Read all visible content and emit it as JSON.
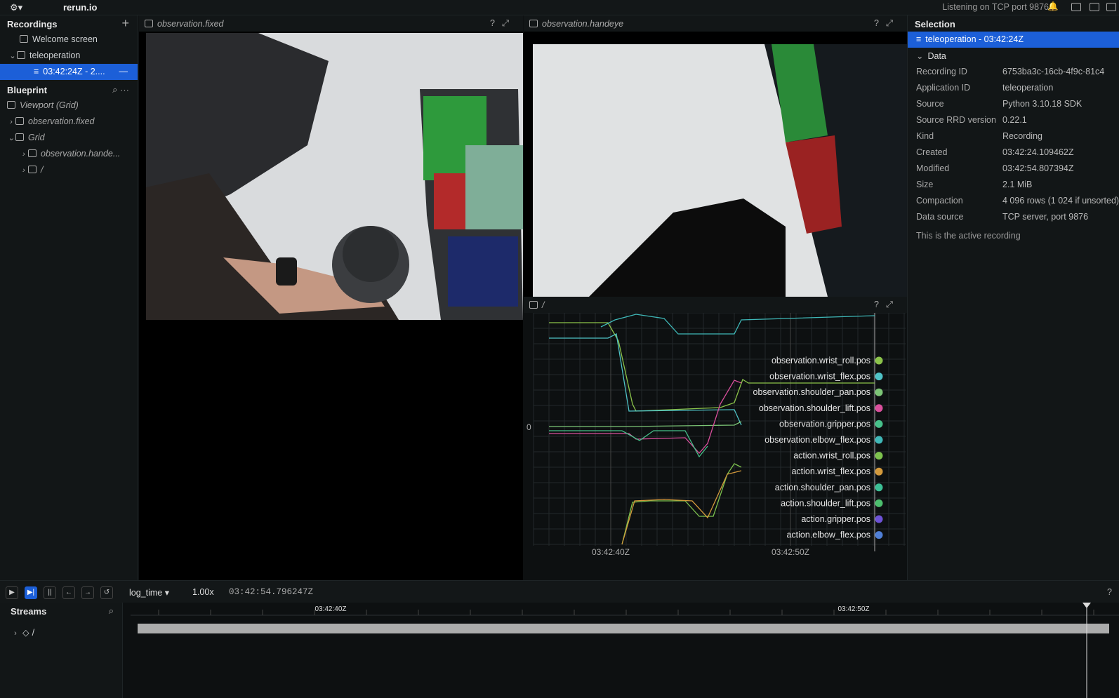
{
  "app": {
    "name": "rerun.io",
    "status": "Listening on TCP port 9876"
  },
  "recordings": {
    "title": "Recordings",
    "items": [
      {
        "label": "Welcome screen"
      },
      {
        "label": "teleoperation"
      },
      {
        "label": "03:42:24Z - 2...."
      }
    ]
  },
  "blueprint": {
    "title": "Blueprint",
    "items": [
      {
        "label": "Viewport (Grid)"
      },
      {
        "label": "observation.fixed"
      },
      {
        "label": "Grid"
      },
      {
        "label": "observation.hande..."
      },
      {
        "label": "/"
      }
    ]
  },
  "views": {
    "fixed": "observation.fixed",
    "handeye": "observation.handeye",
    "plot": "/"
  },
  "selection": {
    "title": "Selection",
    "recording": "teleoperation - 03:42:24Z",
    "data_header": "Data",
    "fields": [
      {
        "k": "Recording ID",
        "v": "6753ba3c-16cb-4f9c-81c4"
      },
      {
        "k": "Application ID",
        "v": "teleoperation"
      },
      {
        "k": "Source",
        "v": "Python 3.10.18 SDK"
      },
      {
        "k": "Source RRD version",
        "v": "0.22.1"
      },
      {
        "k": "Kind",
        "v": "Recording"
      },
      {
        "k": "Created",
        "v": "03:42:24.109462Z"
      },
      {
        "k": "Modified",
        "v": "03:42:54.807394Z"
      },
      {
        "k": "Size",
        "v": "2.1 MiB"
      },
      {
        "k": "Compaction",
        "v": "4 096 rows (1 024 if unsorted)"
      },
      {
        "k": "Data source",
        "v": "TCP server, port 9876"
      }
    ],
    "note": "This is the active recording"
  },
  "timeline": {
    "timeline": "log_time",
    "speed": "1.00x",
    "time": "03:42:54.796247Z",
    "streams": "Streams",
    "root": "/",
    "ticks_major": [
      "03:42:40Z",
      "03:42:50Z"
    ]
  },
  "chart_data": {
    "type": "line",
    "x_ticks": [
      "03:42:40Z",
      "03:42:50Z"
    ],
    "y_ticks": [
      "0"
    ],
    "legend": [
      {
        "name": "observation.wrist_roll.pos",
        "color": "#8bc34a"
      },
      {
        "name": "observation.wrist_flex.pos",
        "color": "#4fc3c7"
      },
      {
        "name": "observation.shoulder_pan.pos",
        "color": "#7cc576"
      },
      {
        "name": "observation.shoulder_lift.pos",
        "color": "#d94f9c"
      },
      {
        "name": "observation.gripper.pos",
        "color": "#46c08a"
      },
      {
        "name": "observation.elbow_flex.pos",
        "color": "#3fb8b8"
      },
      {
        "name": "action.wrist_roll.pos",
        "color": "#7dc24d"
      },
      {
        "name": "action.wrist_flex.pos",
        "color": "#d49a3c"
      },
      {
        "name": "action.shoulder_pan.pos",
        "color": "#3cbf95"
      },
      {
        "name": "action.shoulder_lift.pos",
        "color": "#4cbf6e"
      },
      {
        "name": "action.gripper.pos",
        "color": "#6d52d6"
      },
      {
        "name": "action.elbow_flex.pos",
        "color": "#4f7fd6"
      }
    ]
  }
}
